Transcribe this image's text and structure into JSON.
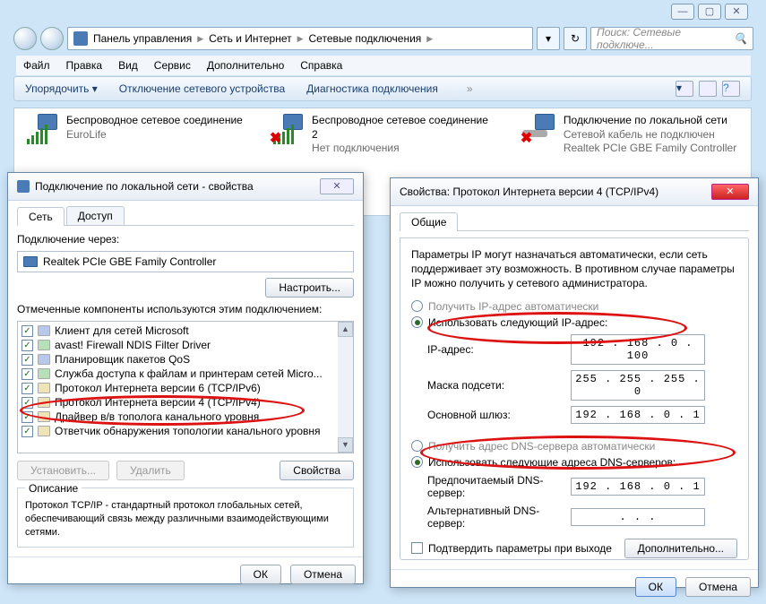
{
  "window_controls": {
    "min": "—",
    "max": "▢",
    "close": "✕"
  },
  "breadcrumb": {
    "p1": "Панель управления",
    "p2": "Сеть и Интернет",
    "p3": "Сетевые подключения"
  },
  "search": {
    "placeholder": "Поиск: Сетевые подключе..."
  },
  "menubar": [
    "Файл",
    "Правка",
    "Вид",
    "Сервис",
    "Дополнительно",
    "Справка"
  ],
  "cmdbar": {
    "organize": "Упорядочить",
    "disable": "Отключение сетевого устройства",
    "diag": "Диагностика подключения"
  },
  "connections": [
    {
      "title": "Беспроводное сетевое соединение",
      "sub1": "EuroLife",
      "sub2": "",
      "type": "wifi"
    },
    {
      "title": "Беспроводное сетевое соединение 2",
      "sub1": "Нет подключения",
      "sub2": "",
      "type": "wifi-x"
    },
    {
      "title": "Подключение по локальной сети",
      "sub1": "Сетевой кабель не подключен",
      "sub2": "Realtek PCIe GBE Family Controller",
      "type": "lan-x"
    }
  ],
  "props1": {
    "title": "Подключение по локальной сети - свойства",
    "tab_net": "Сеть",
    "tab_access": "Доступ",
    "conn_via": "Подключение через:",
    "adapter": "Realtek PCIe GBE Family Controller",
    "configure": "Настроить...",
    "components_label": "Отмеченные компоненты используются этим подключением:",
    "components": [
      "Клиент для сетей Microsoft",
      "avast! Firewall NDIS Filter Driver",
      "Планировщик пакетов QoS",
      "Служба доступа к файлам и принтерам сетей Micro...",
      "Протокол Интернета версии 6 (TCP/IPv6)",
      "Протокол Интернета версии 4 (TCP/IPv4)",
      "Драйвер в/в тополога канального уровня",
      "Ответчик обнаружения топологии канального уровня"
    ],
    "install": "Установить...",
    "remove": "Удалить",
    "props": "Свойства",
    "desc_title": "Описание",
    "desc_body": "Протокол TCP/IP - стандартный протокол глобальных сетей, обеспечивающий связь между различными взаимодействующими сетями.",
    "ok": "ОК",
    "cancel": "Отмена"
  },
  "props2": {
    "title": "Свойства: Протокол Интернета версии 4 (TCP/IPv4)",
    "tab": "Общие",
    "intro": "Параметры IP могут назначаться автоматически, если сеть поддерживает эту возможность. В противном случае параметры IP можно получить у сетевого администратора.",
    "r1": "Получить IP-адрес автоматически",
    "r2": "Использовать следующий IP-адрес:",
    "lbl_ip": "IP-адрес:",
    "lbl_mask": "Маска подсети:",
    "lbl_gw": "Основной шлюз:",
    "ip": "192 . 168 .  0  . 100",
    "mask": "255 . 255 . 255 .  0",
    "gw": "192 . 168 .  0  .  1",
    "r3": "Получить адрес DNS-сервера автоматически",
    "r4": "Использовать следующие адреса DNS-серверов:",
    "lbl_dns1": "Предпочитаемый DNS-сервер:",
    "lbl_dns2": "Альтернативный DNS-сервер:",
    "dns1": "192 . 168 .  0  .  1",
    "dns2": " .     .     . ",
    "confirm": "Подтвердить параметры при выходе",
    "advanced": "Дополнительно...",
    "ok": "ОК",
    "cancel": "Отмена"
  }
}
